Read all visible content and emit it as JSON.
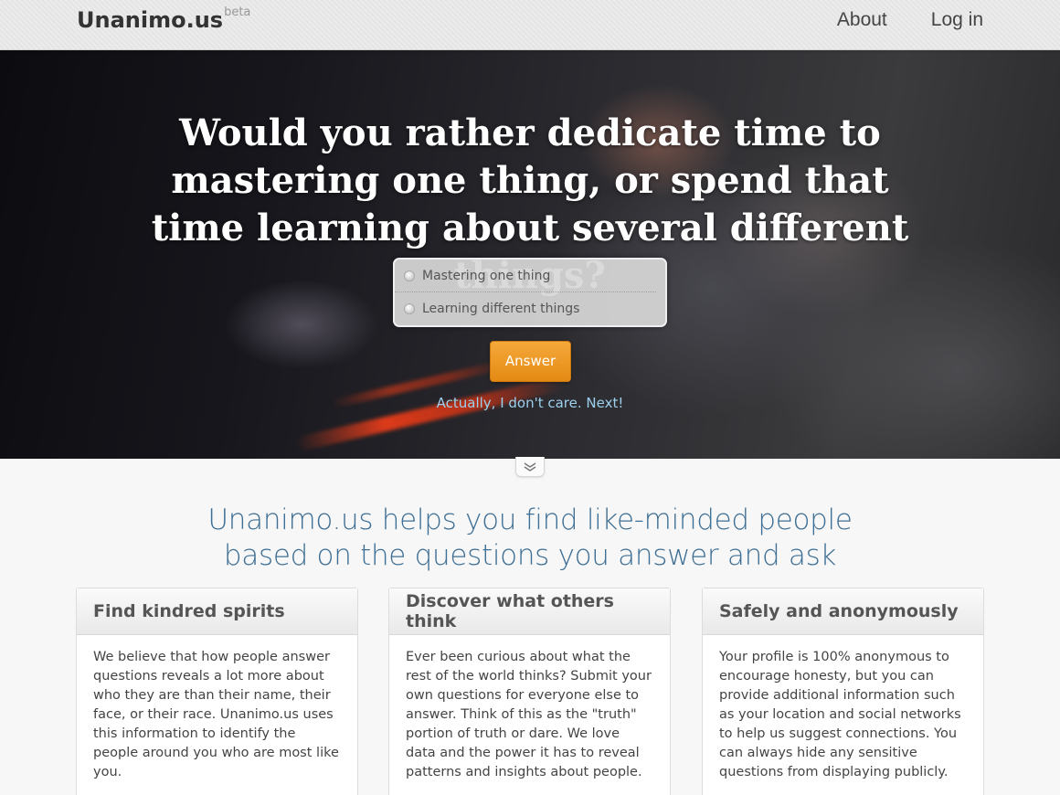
{
  "header": {
    "logo": "Unanimo.us",
    "badge": "beta",
    "nav": [
      {
        "label": "About"
      },
      {
        "label": "Log in"
      }
    ]
  },
  "hero": {
    "question": "Would you rather dedicate time to mastering one thing, or spend that time learning about several different things?",
    "options": [
      {
        "label": "Mastering one thing",
        "selected": false
      },
      {
        "label": "Learning different things",
        "selected": false
      }
    ],
    "answer_label": "Answer",
    "skip_label": "Actually, I don't care. Next!"
  },
  "expand_icon": "double-chevron-down-icon",
  "tagline_line1": "Unanimo.us helps you find like-minded people",
  "tagline_line2": "based on the questions you answer and ask",
  "cards": [
    {
      "title": "Find kindred spirits",
      "body": "We believe that how people answer questions reveals a lot more about who they are than their name, their face, or their race. Unanimo.us uses this information to identify the people around you who are most like you."
    },
    {
      "title": "Discover what others think",
      "body": "Ever been curious about what the rest of the world thinks? Submit your own questions for everyone else to answer. Think of this as the \"truth\" portion of truth or dare. We love data and the power it has to reveal patterns and insights about people."
    },
    {
      "title": "Safely and anonymously",
      "body": "Your profile is 100% anonymous to encourage honesty, but you can provide additional information such as your location and social networks to help us suggest connections. You can always hide any sensitive questions from displaying publicly."
    }
  ],
  "colors": {
    "accent_orange": "#e8921c",
    "tagline_blue": "#3f6f94",
    "link_blue": "#9cd0ec"
  }
}
